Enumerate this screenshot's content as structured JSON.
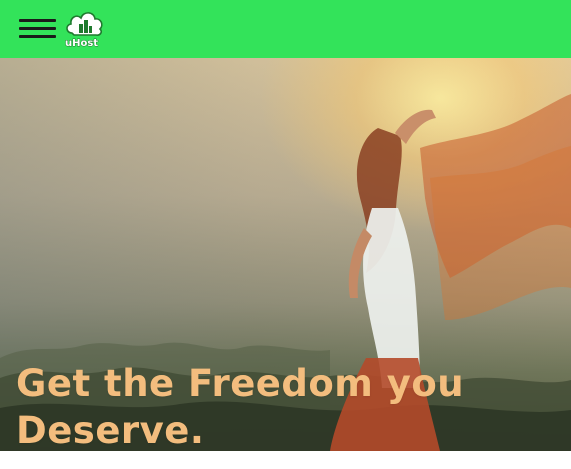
{
  "header": {
    "logo_text": "uHost",
    "menu_icon": "hamburger-menu-icon",
    "background_color": "#33e35a"
  },
  "hero": {
    "headline": "Get the Freedom you Deserve.",
    "headline_color": "#f3bd7e"
  }
}
